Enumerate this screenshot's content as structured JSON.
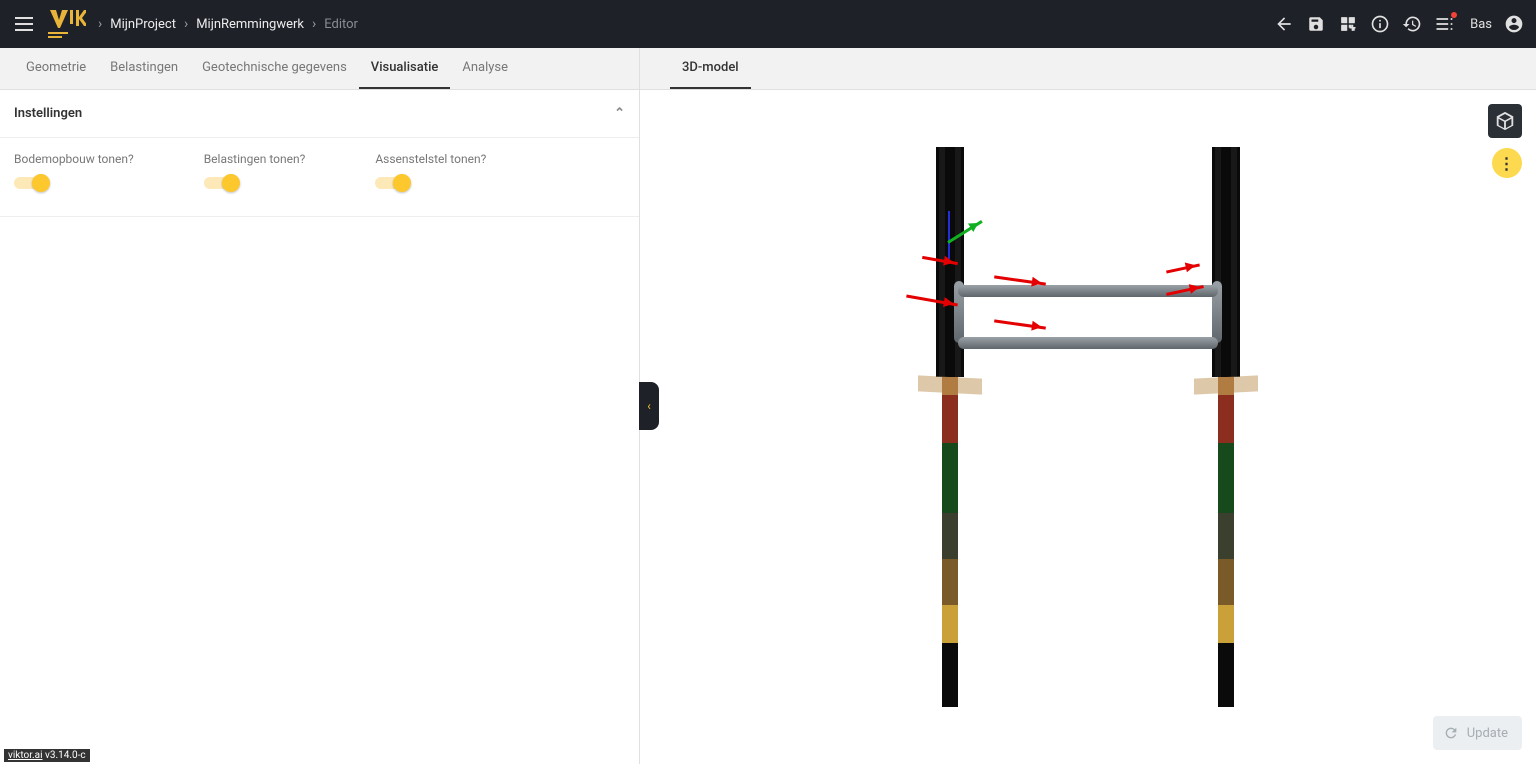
{
  "header": {
    "breadcrumbs": [
      "MijnProject",
      "MijnRemmingwerk",
      "Editor"
    ],
    "user": "Bas"
  },
  "left_tabs": [
    {
      "label": "Geometrie",
      "active": false
    },
    {
      "label": "Belastingen",
      "active": false
    },
    {
      "label": "Geotechnische gegevens",
      "active": false
    },
    {
      "label": "Visualisatie",
      "active": true
    },
    {
      "label": "Analyse",
      "active": false
    }
  ],
  "right_tabs": [
    {
      "label": "3D-model",
      "active": true
    }
  ],
  "section": {
    "title": "Instellingen",
    "toggles": [
      {
        "label": "Bodemopbouw tonen?",
        "value": true
      },
      {
        "label": "Belastingen tonen?",
        "value": true
      },
      {
        "label": "Assenstelstel tonen?",
        "value": true
      }
    ]
  },
  "update_button": {
    "label": "Update"
  },
  "footer": {
    "link": "viktor.ai",
    "version": "v3.14.0-c"
  }
}
